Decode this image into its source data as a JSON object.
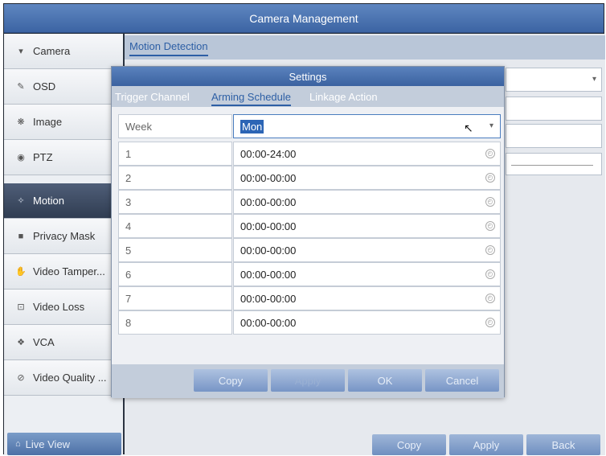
{
  "window": {
    "title": "Camera Management"
  },
  "sidebar": {
    "items": [
      {
        "label": "Camera",
        "icon": "camera-icon",
        "glyph": "▾"
      },
      {
        "label": "OSD",
        "icon": "osd-icon",
        "glyph": "✎"
      },
      {
        "label": "Image",
        "icon": "image-icon",
        "glyph": "❋"
      },
      {
        "label": "PTZ",
        "icon": "ptz-icon",
        "glyph": "◉"
      },
      {
        "label": "Motion",
        "icon": "motion-icon",
        "glyph": "✧",
        "active": true
      },
      {
        "label": "Privacy Mask",
        "icon": "privacy-mask-icon",
        "glyph": "■"
      },
      {
        "label": "Video Tamper...",
        "icon": "video-tamper-icon",
        "glyph": "✋"
      },
      {
        "label": "Video Loss",
        "icon": "video-loss-icon",
        "glyph": "⊡"
      },
      {
        "label": "VCA",
        "icon": "vca-icon",
        "glyph": "❖"
      },
      {
        "label": "Video Quality ...",
        "icon": "video-quality-icon",
        "glyph": "⊘"
      }
    ],
    "live_view": {
      "label": "Live View",
      "icon": "home-icon",
      "glyph": "⌂"
    }
  },
  "main": {
    "tab": "Motion Detection",
    "buttons": {
      "copy": "Copy",
      "apply": "Apply",
      "back": "Back"
    }
  },
  "dialog": {
    "title": "Settings",
    "tabs": [
      {
        "label": "Trigger Channel",
        "active": false
      },
      {
        "label": "Arming Schedule",
        "active": true
      },
      {
        "label": "Linkage Action",
        "active": false
      }
    ],
    "week": {
      "label": "Week",
      "value": "Mon"
    },
    "periods": [
      {
        "index": "1",
        "time": "00:00-24:00"
      },
      {
        "index": "2",
        "time": "00:00-00:00"
      },
      {
        "index": "3",
        "time": "00:00-00:00"
      },
      {
        "index": "4",
        "time": "00:00-00:00"
      },
      {
        "index": "5",
        "time": "00:00-00:00"
      },
      {
        "index": "6",
        "time": "00:00-00:00"
      },
      {
        "index": "7",
        "time": "00:00-00:00"
      },
      {
        "index": "8",
        "time": "00:00-00:00"
      }
    ],
    "buttons": {
      "copy": "Copy",
      "apply": "Apply",
      "ok": "OK",
      "cancel": "Cancel"
    }
  },
  "colors": {
    "title_bar": "#3c64a3",
    "accent": "#2d5fa5",
    "active_sidebar": "#303d52"
  }
}
